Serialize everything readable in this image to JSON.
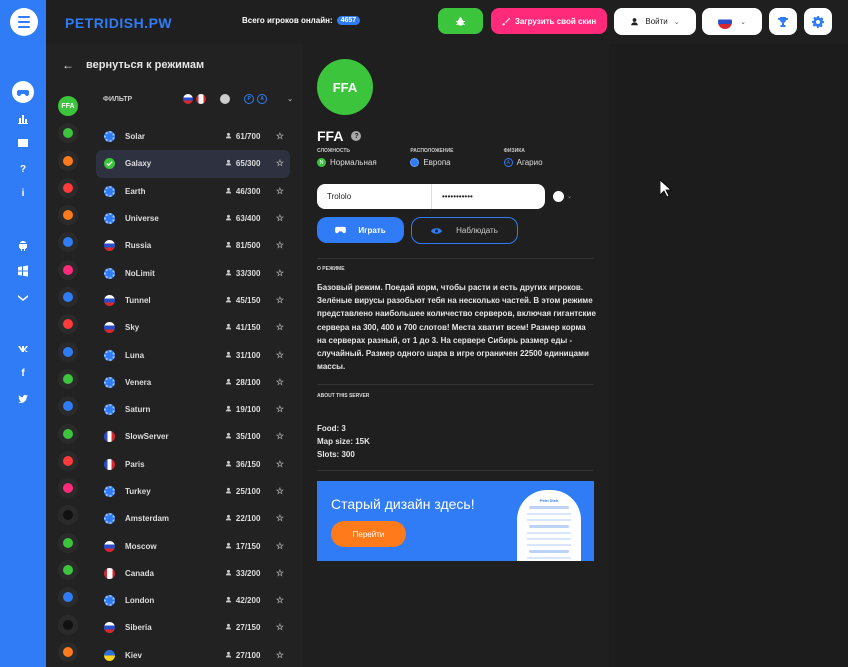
{
  "header": {
    "logo": "PETRIDISH.PW",
    "online_label": "Всего игроков онлайн:",
    "online_count": "4657",
    "upload_skin": "Загрузить свой скин",
    "login": "Войти"
  },
  "panel": {
    "back_label": "вернуться к режимам",
    "filter_label": "ФИЛЬТР",
    "mode_icons": [
      "ffa",
      "duo",
      "hand",
      "cell",
      "fire",
      "team",
      "pig",
      "beta",
      "hand2",
      "nolimit",
      "grid",
      "wave",
      "ring",
      "gun",
      "skull",
      "dark",
      "eye",
      "virus",
      "ghost",
      "circle",
      "car"
    ],
    "active_mode_short": "FFA"
  },
  "servers": [
    {
      "name": "Solar",
      "flag": "eu",
      "slots": "61/700",
      "selected": false
    },
    {
      "name": "Galaxy",
      "flag": "check",
      "slots": "65/300",
      "selected": true
    },
    {
      "name": "Earth",
      "flag": "eu",
      "slots": "46/300",
      "selected": false
    },
    {
      "name": "Universe",
      "flag": "eu",
      "slots": "63/400",
      "selected": false
    },
    {
      "name": "Russia",
      "flag": "ru",
      "slots": "81/500",
      "selected": false
    },
    {
      "name": "NoLimit",
      "flag": "eu",
      "slots": "33/300",
      "selected": false
    },
    {
      "name": "Tunnel",
      "flag": "ru",
      "slots": "45/150",
      "selected": false
    },
    {
      "name": "Sky",
      "flag": "ru",
      "slots": "41/150",
      "selected": false
    },
    {
      "name": "Luna",
      "flag": "eu",
      "slots": "31/100",
      "selected": false
    },
    {
      "name": "Venera",
      "flag": "eu",
      "slots": "28/100",
      "selected": false
    },
    {
      "name": "Saturn",
      "flag": "eu",
      "slots": "19/100",
      "selected": false
    },
    {
      "name": "SlowServer",
      "flag": "fr",
      "slots": "35/100",
      "selected": false
    },
    {
      "name": "Paris",
      "flag": "fr",
      "slots": "36/150",
      "selected": false
    },
    {
      "name": "Turkey",
      "flag": "eu",
      "slots": "25/100",
      "selected": false
    },
    {
      "name": "Amsterdam",
      "flag": "eu",
      "slots": "22/100",
      "selected": false
    },
    {
      "name": "Moscow",
      "flag": "ru",
      "slots": "17/150",
      "selected": false
    },
    {
      "name": "Canada",
      "flag": "ca",
      "slots": "33/200",
      "selected": false
    },
    {
      "name": "London",
      "flag": "eu",
      "slots": "42/200",
      "selected": false
    },
    {
      "name": "Siberia",
      "flag": "ru",
      "slots": "27/150",
      "selected": false
    },
    {
      "name": "Kiev",
      "flag": "ua",
      "slots": "27/100",
      "selected": false
    }
  ],
  "detail": {
    "avatar_text": "FFA",
    "title": "FFA",
    "props": [
      {
        "label": "СЛОЖНОСТЬ",
        "value": "Нормальная",
        "icon": "N",
        "color": "#3cc43c"
      },
      {
        "label": "РАСПОЛОЖЕНИЕ",
        "value": "Европа",
        "icon": "eu",
        "color": "#2f7cf6"
      },
      {
        "label": "ФИЗИКА",
        "value": "Агарио",
        "icon": "A",
        "color": "#2f7cf6"
      }
    ],
    "nick_value": "Trololo",
    "tag_value": "•••••••••••",
    "play": "Играть",
    "watch": "Наблюдать",
    "about_label": "О РЕЖИМЕ",
    "about_text": "Базовый режим. Поедай корм, чтобы расти и есть других игроков. Зелёные вирусы разобьют тебя на несколько частей. В этом режиме представлено наибольшее количество серверов, включая гигантские сервера на 300, 400 и 700 слотов! Места хватит всем! Размер корма на серверах разный, от 1 до 3. На сервере Сибирь размер еды - случайный. Размер одного шара в игре ограничен 22500 единицами массы.",
    "server_label": "ABOUT THIS SERVER",
    "food": "Food: 3",
    "map_size": "Map size: 15K",
    "slots": "Slots: 300",
    "promo_text": "Старый дизайн здесь!",
    "promo_button": "Перейти",
    "promo_phone_title": "Petri Dish"
  },
  "colors": {
    "accent": "#2f7cf6",
    "green": "#3cc43c",
    "pink": "#ff2a7a",
    "orange": "#ff7a1a"
  }
}
